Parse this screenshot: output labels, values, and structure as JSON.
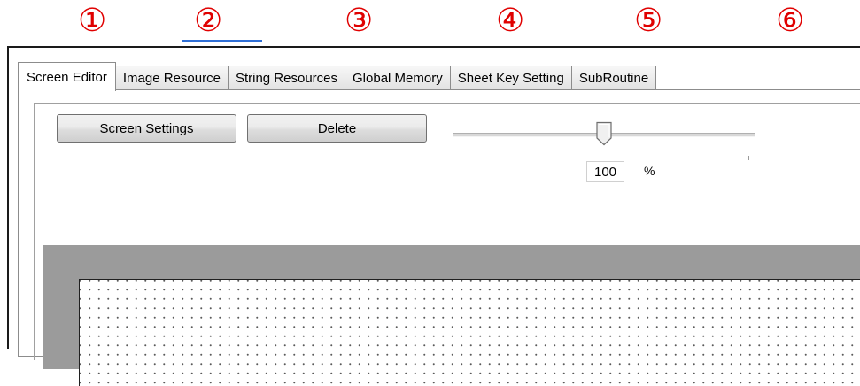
{
  "callouts": [
    "①",
    "②",
    "③",
    "④",
    "⑤",
    "⑥"
  ],
  "tabs": [
    {
      "label": "Screen Editor",
      "active": true
    },
    {
      "label": "Image Resource",
      "active": false
    },
    {
      "label": "String Resources",
      "active": false
    },
    {
      "label": "Global Memory",
      "active": false
    },
    {
      "label": "Sheet Key Setting",
      "active": false
    },
    {
      "label": "SubRoutine",
      "active": false
    }
  ],
  "toolbar": {
    "screen_settings_label": "Screen Settings",
    "delete_label": "Delete"
  },
  "zoom": {
    "value": "100",
    "unit": "%",
    "slider_fraction": 0.5
  },
  "colors": {
    "callout": "#e00000",
    "canvas_background": "#9b9b9b",
    "grid_dot": "#5a5a5a"
  }
}
